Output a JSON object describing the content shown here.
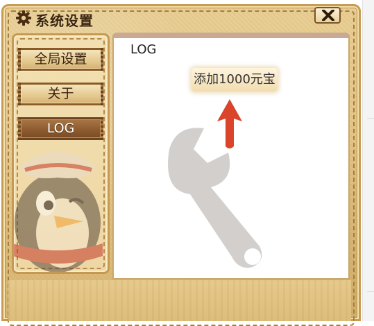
{
  "window": {
    "title": "系统设置",
    "title_icon": "gear-icon",
    "close_icon": "close-icon"
  },
  "sidebar": {
    "items": [
      {
        "label": "全局设置",
        "active": false
      },
      {
        "label": "关于",
        "active": false
      },
      {
        "label": "LOG",
        "active": true
      }
    ]
  },
  "content": {
    "heading": "LOG",
    "action_button": "添加1000元宝",
    "annotation_icon": "red-arrow-up-icon",
    "annotation_color": "#d9442b"
  },
  "colors": {
    "frame": "#e3c486",
    "frame_border": "#c79c52",
    "active_tab": "#8e5c30",
    "title_text": "#3b2510"
  }
}
